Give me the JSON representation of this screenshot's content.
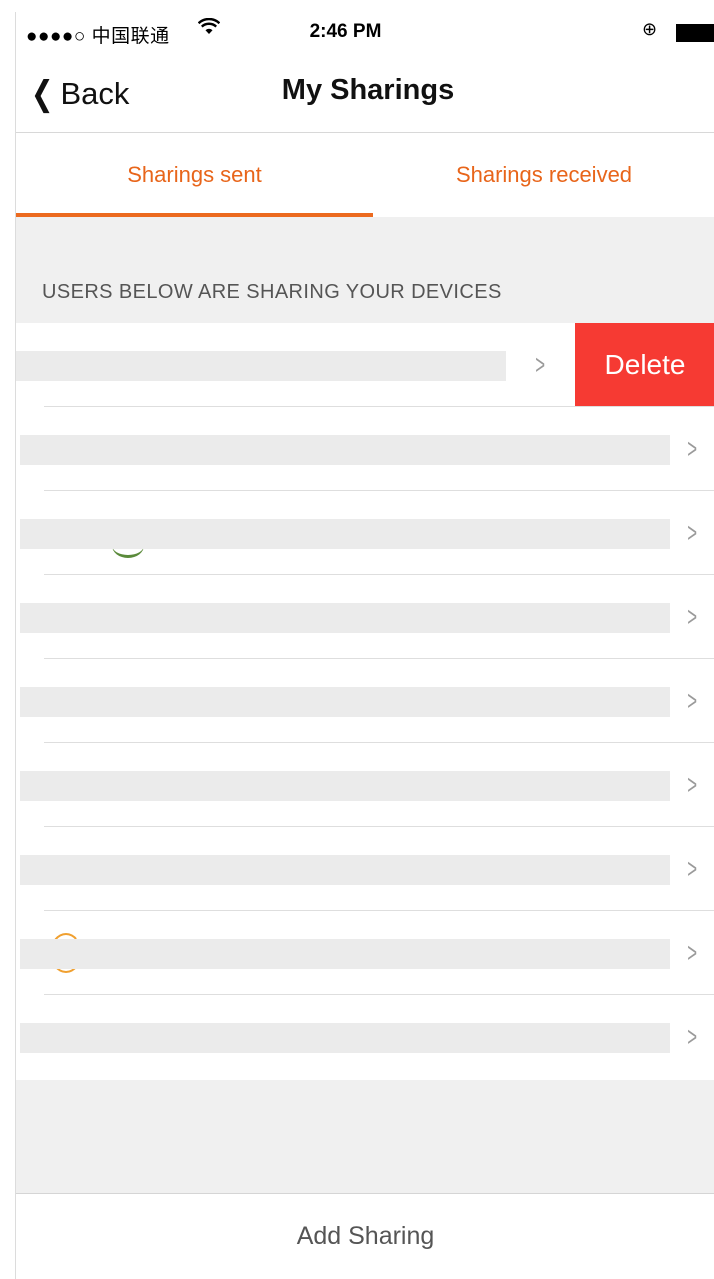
{
  "status_bar": {
    "carrier": "●●●●○ 中国联通",
    "wifi_icon": "wifi-icon",
    "time": "2:46 PM",
    "lock_icon": "⊕",
    "battery_icon": "battery-icon"
  },
  "nav": {
    "back_label": "Back",
    "back_chevron": "❮",
    "title": "My Sharings"
  },
  "tabs": [
    {
      "label": "Sharings sent",
      "active": true
    },
    {
      "label": "Sharings received",
      "active": false
    }
  ],
  "section": {
    "header": "USERS BELOW ARE SHARING YOUR DEVICES"
  },
  "list": {
    "chevron": ">",
    "delete_label": "Delete",
    "row_count": 9
  },
  "footer": {
    "add_label": "Add Sharing"
  },
  "colors": {
    "accent": "#ec6a1f",
    "delete": "#f63a33",
    "background_grey": "#f0f0f0"
  }
}
